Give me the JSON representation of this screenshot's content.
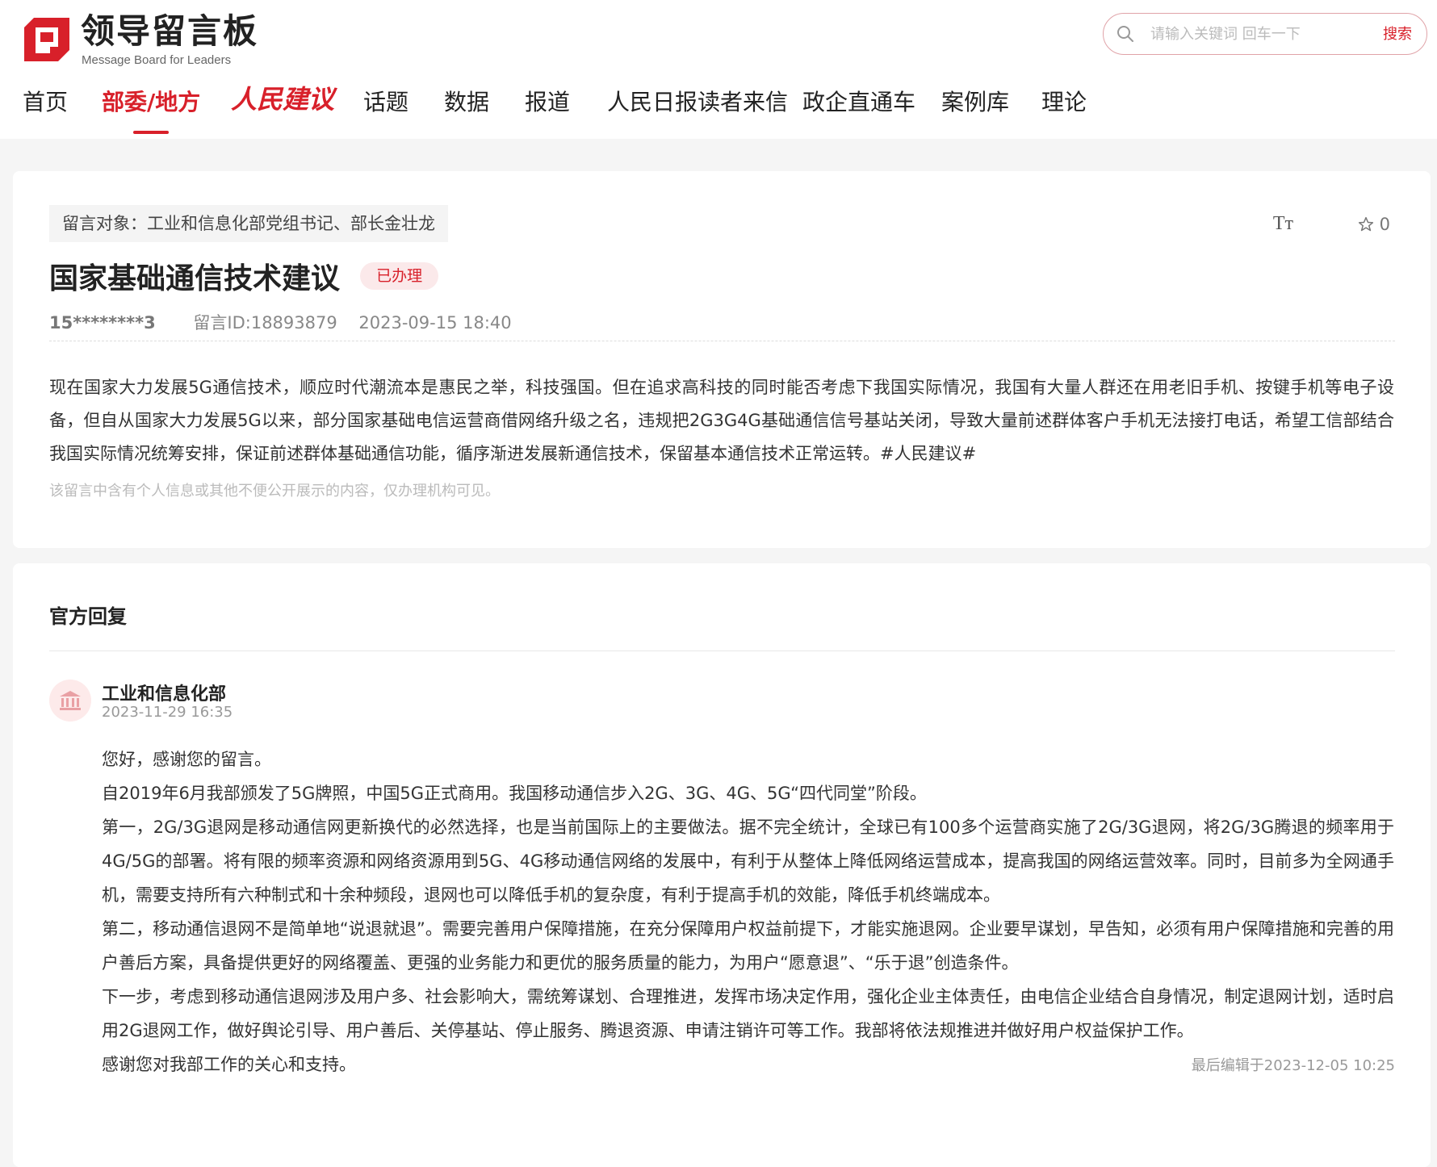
{
  "header": {
    "logo_title": "领导留言板",
    "logo_subtitle": "Message Board for Leaders",
    "brand_color": "#d8202a",
    "search": {
      "placeholder": "请输入关键词 回车一下",
      "button_label": "搜索",
      "value": ""
    }
  },
  "nav": {
    "items": [
      {
        "label": "首页"
      },
      {
        "label": "部委/地方",
        "active": true
      },
      {
        "label": "人民建议"
      },
      {
        "label": "话题"
      },
      {
        "label": "数据"
      },
      {
        "label": "报道"
      },
      {
        "label": "人民日报读者来信"
      },
      {
        "label": "政企直通车"
      },
      {
        "label": "案例库"
      },
      {
        "label": "理论"
      }
    ]
  },
  "message": {
    "target": "留言对象：工业和信息化部党组书记、部长金壮龙",
    "font_tool": "Tт",
    "favorite_count": "0",
    "title": "国家基础通信技术建议",
    "status": "已办理",
    "author": "15********3",
    "message_id": "留言ID:18893879",
    "datetime": "2023-09-15 18:40",
    "body": "现在国家大力发展5G通信技术，顺应时代潮流本是惠民之举，科技强国。但在追求高科技的同时能否考虑下我国实际情况，我国有大量人群还在用老旧手机、按键手机等电子设备，但自从国家大力发展5G以来，部分国家基础电信运营商借网络升级之名，违规把2G3G4G基础通信信号基站关闭，导致大量前述群体客户手机无法接打电话，希望工信部结合我国实际情况统筹安排，保证前述群体基础通信功能，循序渐进发展新通信技术，保留基本通信技术正常运转。#人民建议#",
    "privacy_note": "该留言中含有个人信息或其他不便公开展示的内容，仅办理机构可见。"
  },
  "reply": {
    "header": "官方回复",
    "department": "工业和信息化部",
    "datetime": "2023-11-29 16:35",
    "paragraphs": [
      "您好，感谢您的留言。",
      "自2019年6月我部颁发了5G牌照，中国5G正式商用。我国移动通信步入2G、3G、4G、5G“四代同堂”阶段。",
      "第一，2G/3G退网是移动通信网更新换代的必然选择，也是当前国际上的主要做法。据不完全统计，全球已有100多个运营商实施了2G/3G退网，将2G/3G腾退的频率用于4G/5G的部署。将有限的频率资源和网络资源用到5G、4G移动通信网络的发展中，有利于从整体上降低网络运营成本，提高我国的网络运营效率。同时，目前多为全网通手机，需要支持所有六种制式和十余种频段，退网也可以降低手机的复杂度，有利于提高手机的效能，降低手机终端成本。",
      "第二，移动通信退网不是简单地“说退就退”。需要完善用户保障措施，在充分保障用户权益前提下，才能实施退网。企业要早谋划，早告知，必须有用户保障措施和完善的用户善后方案，具备提供更好的网络覆盖、更强的业务能力和更优的服务质量的能力，为用户“愿意退”、“乐于退”创造条件。",
      "下一步，考虑到移动通信退网涉及用户多、社会影响大，需统筹谋划、合理推进，发挥市场决定作用，强化企业主体责任，由电信企业结合自身情况，制定退网计划，适时启用2G退网工作，做好舆论引导、用户善后、关停基站、停止服务、腾退资源、申请注销许可等工作。我部将依法规推进并做好用户权益保护工作。",
      "感谢您对我部工作的关心和支持。"
    ],
    "last_edited": "最后编辑于2023-12-05 10:25"
  }
}
